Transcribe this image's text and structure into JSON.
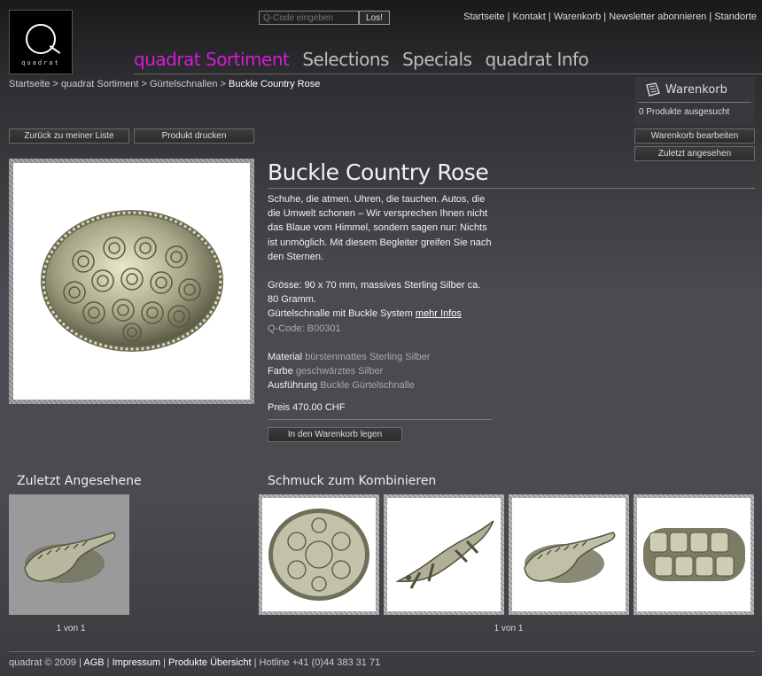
{
  "logo": {
    "text": "quadrat"
  },
  "search": {
    "placeholder": "Q-Code eingeben",
    "button": "Los!"
  },
  "toplinks": [
    "Startseite",
    "Kontakt",
    "Warenkorb",
    "Newsletter abonnieren",
    "Standorte"
  ],
  "nav": [
    "quadrat Sortiment",
    "Selections",
    "Specials",
    "quadrat Info"
  ],
  "breadcrumb": {
    "items": [
      "Startseite",
      "quadrat Sortiment",
      "Gürtelschnallen"
    ],
    "current": "Buckle Country Rose",
    "sep": " > "
  },
  "actions": {
    "back": "Zurück zu meiner Liste",
    "print": "Produkt drucken"
  },
  "cart": {
    "title": "Warenkorb",
    "count": "0 Produkte ausgesucht",
    "edit": "Warenkorb bearbeiten",
    "recent": "Zuletzt angesehen"
  },
  "product": {
    "title": "Buckle Country Rose",
    "description": "Schuhe, die atmen. Uhren, die tauchen. Autos, die die Umwelt schonen – Wir versprechen Ihnen nicht das Blaue vom Himmel, sondern sagen nur: Nichts ist unmöglich. Mit diesem Begleiter greifen Sie nach den Sternen.",
    "size": "Grösse: 90 x 70 mm, massives Sterling Silber ca. 80 Gramm.",
    "system": "Gürtelschnalle mit Buckle System",
    "more_link": "mehr Infos",
    "qcode": "Q-Code: B00301",
    "material_label": "Material",
    "material": "bürstenmattes Sterling Silber",
    "color_label": "Farbe",
    "color": "geschwärztes Silber",
    "style_label": "Ausführung",
    "style": "Buckle Gürtelschnalle",
    "price": "Preis 470.00 CHF",
    "add_to_cart": "In den Warenkorb legen"
  },
  "recent": {
    "title": "Zuletzt Angesehene",
    "pager": "1 von 1"
  },
  "combine": {
    "title": "Schmuck zum Kombinieren",
    "pager": "1 von 1"
  },
  "footer": {
    "copyright": "quadrat © 2009",
    "links": [
      "AGB",
      "Impressum",
      "Produkte Übersicht"
    ],
    "hotline": "Hotline +41 (0)44 383 31 71"
  },
  "colors": {
    "accent": "#d61bd6",
    "background": "#4a4b50",
    "silver": "#c8c9b0"
  }
}
